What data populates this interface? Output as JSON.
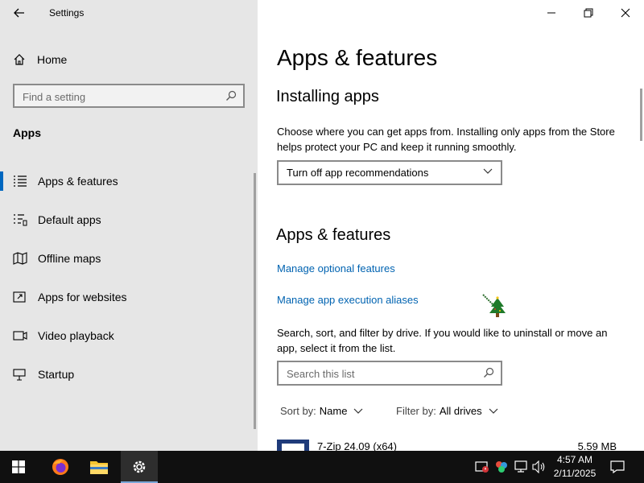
{
  "window": {
    "title": "Settings"
  },
  "sidebar": {
    "home_label": "Home",
    "search_placeholder": "Find a setting",
    "section_heading": "Apps",
    "items": [
      {
        "label": "Apps & features",
        "icon": "list-icon",
        "active": true
      },
      {
        "label": "Default apps",
        "icon": "default-apps-icon",
        "active": false
      },
      {
        "label": "Offline maps",
        "icon": "map-icon",
        "active": false
      },
      {
        "label": "Apps for websites",
        "icon": "open-link-icon",
        "active": false
      },
      {
        "label": "Video playback",
        "icon": "video-icon",
        "active": false
      },
      {
        "label": "Startup",
        "icon": "startup-icon",
        "active": false
      }
    ]
  },
  "main": {
    "page_title": "Apps & features",
    "installing": {
      "heading": "Installing apps",
      "description": "Choose where you can get apps from. Installing only apps from the Store helps protect your PC and keep it running smoothly.",
      "dropdown_value": "Turn off app recommendations"
    },
    "features": {
      "heading": "Apps & features",
      "link_optional": "Manage optional features",
      "link_aliases": "Manage app execution aliases",
      "description": "Search, sort, and filter by drive. If you would like to uninstall or move an app, select it from the list.",
      "search_placeholder": "Search this list",
      "sort_label": "Sort by:",
      "sort_value": "Name",
      "filter_label": "Filter by:",
      "filter_value": "All drives"
    },
    "apps": [
      {
        "name": "7-Zip 24.09 (x64)",
        "size": "5.59 MB"
      }
    ]
  },
  "taskbar": {
    "time": "4:57 AM",
    "date": "2/11/2025"
  },
  "colors": {
    "accent": "#0067c0",
    "link": "#0063b1",
    "sidebar_bg": "#e6e6e6",
    "taskbar_bg": "#101010"
  }
}
